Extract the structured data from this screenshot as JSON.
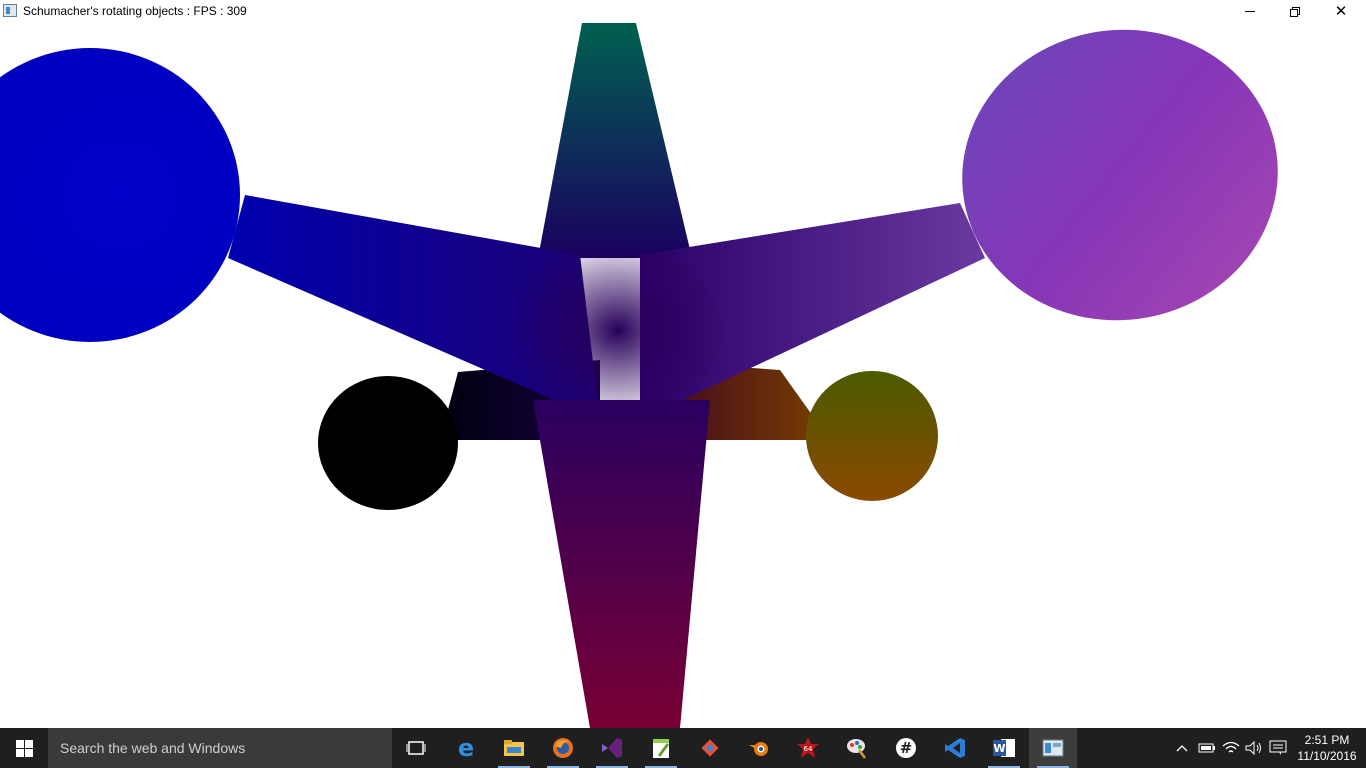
{
  "window": {
    "title": "Schumacher's rotating objects : FPS : 309",
    "minimize_glyph": "—",
    "close_glyph": "✕"
  },
  "scene": {
    "background_color": "#ffffff",
    "colors": {
      "left_sphere": "#0000c8",
      "right_sphere": "#8a3cb8",
      "back_left_sphere": "#000000",
      "back_right_sphere": "#7a4a00",
      "top_arm_tip": "#006050",
      "bottom_arm_tip": "#700038",
      "center": "#2a0060"
    }
  },
  "taskbar": {
    "search_placeholder": "Search the web and Windows",
    "apps": [
      {
        "name": "task-view",
        "glyph": "▭"
      },
      {
        "name": "edge",
        "glyph": "e"
      },
      {
        "name": "file-explorer",
        "glyph": "📁"
      },
      {
        "name": "firefox",
        "glyph": "🦊"
      },
      {
        "name": "visual-studio",
        "glyph": "∞"
      },
      {
        "name": "notepad-plus",
        "glyph": "✎"
      },
      {
        "name": "git",
        "glyph": "◆"
      },
      {
        "name": "blender",
        "glyph": "◉"
      },
      {
        "name": "app-64",
        "glyph": "✸"
      },
      {
        "name": "paint",
        "glyph": "✿"
      },
      {
        "name": "slack",
        "glyph": "#"
      },
      {
        "name": "vs-code",
        "glyph": "❯"
      },
      {
        "name": "word",
        "glyph": "W"
      },
      {
        "name": "rotating-objects",
        "glyph": "▣"
      }
    ],
    "tray": {
      "chevron": "^",
      "battery": "▭",
      "wifi": "◠",
      "volume": "🔈",
      "notifications": "▤"
    },
    "clock": {
      "time": "2:51 PM",
      "date": "11/10/2016"
    }
  }
}
